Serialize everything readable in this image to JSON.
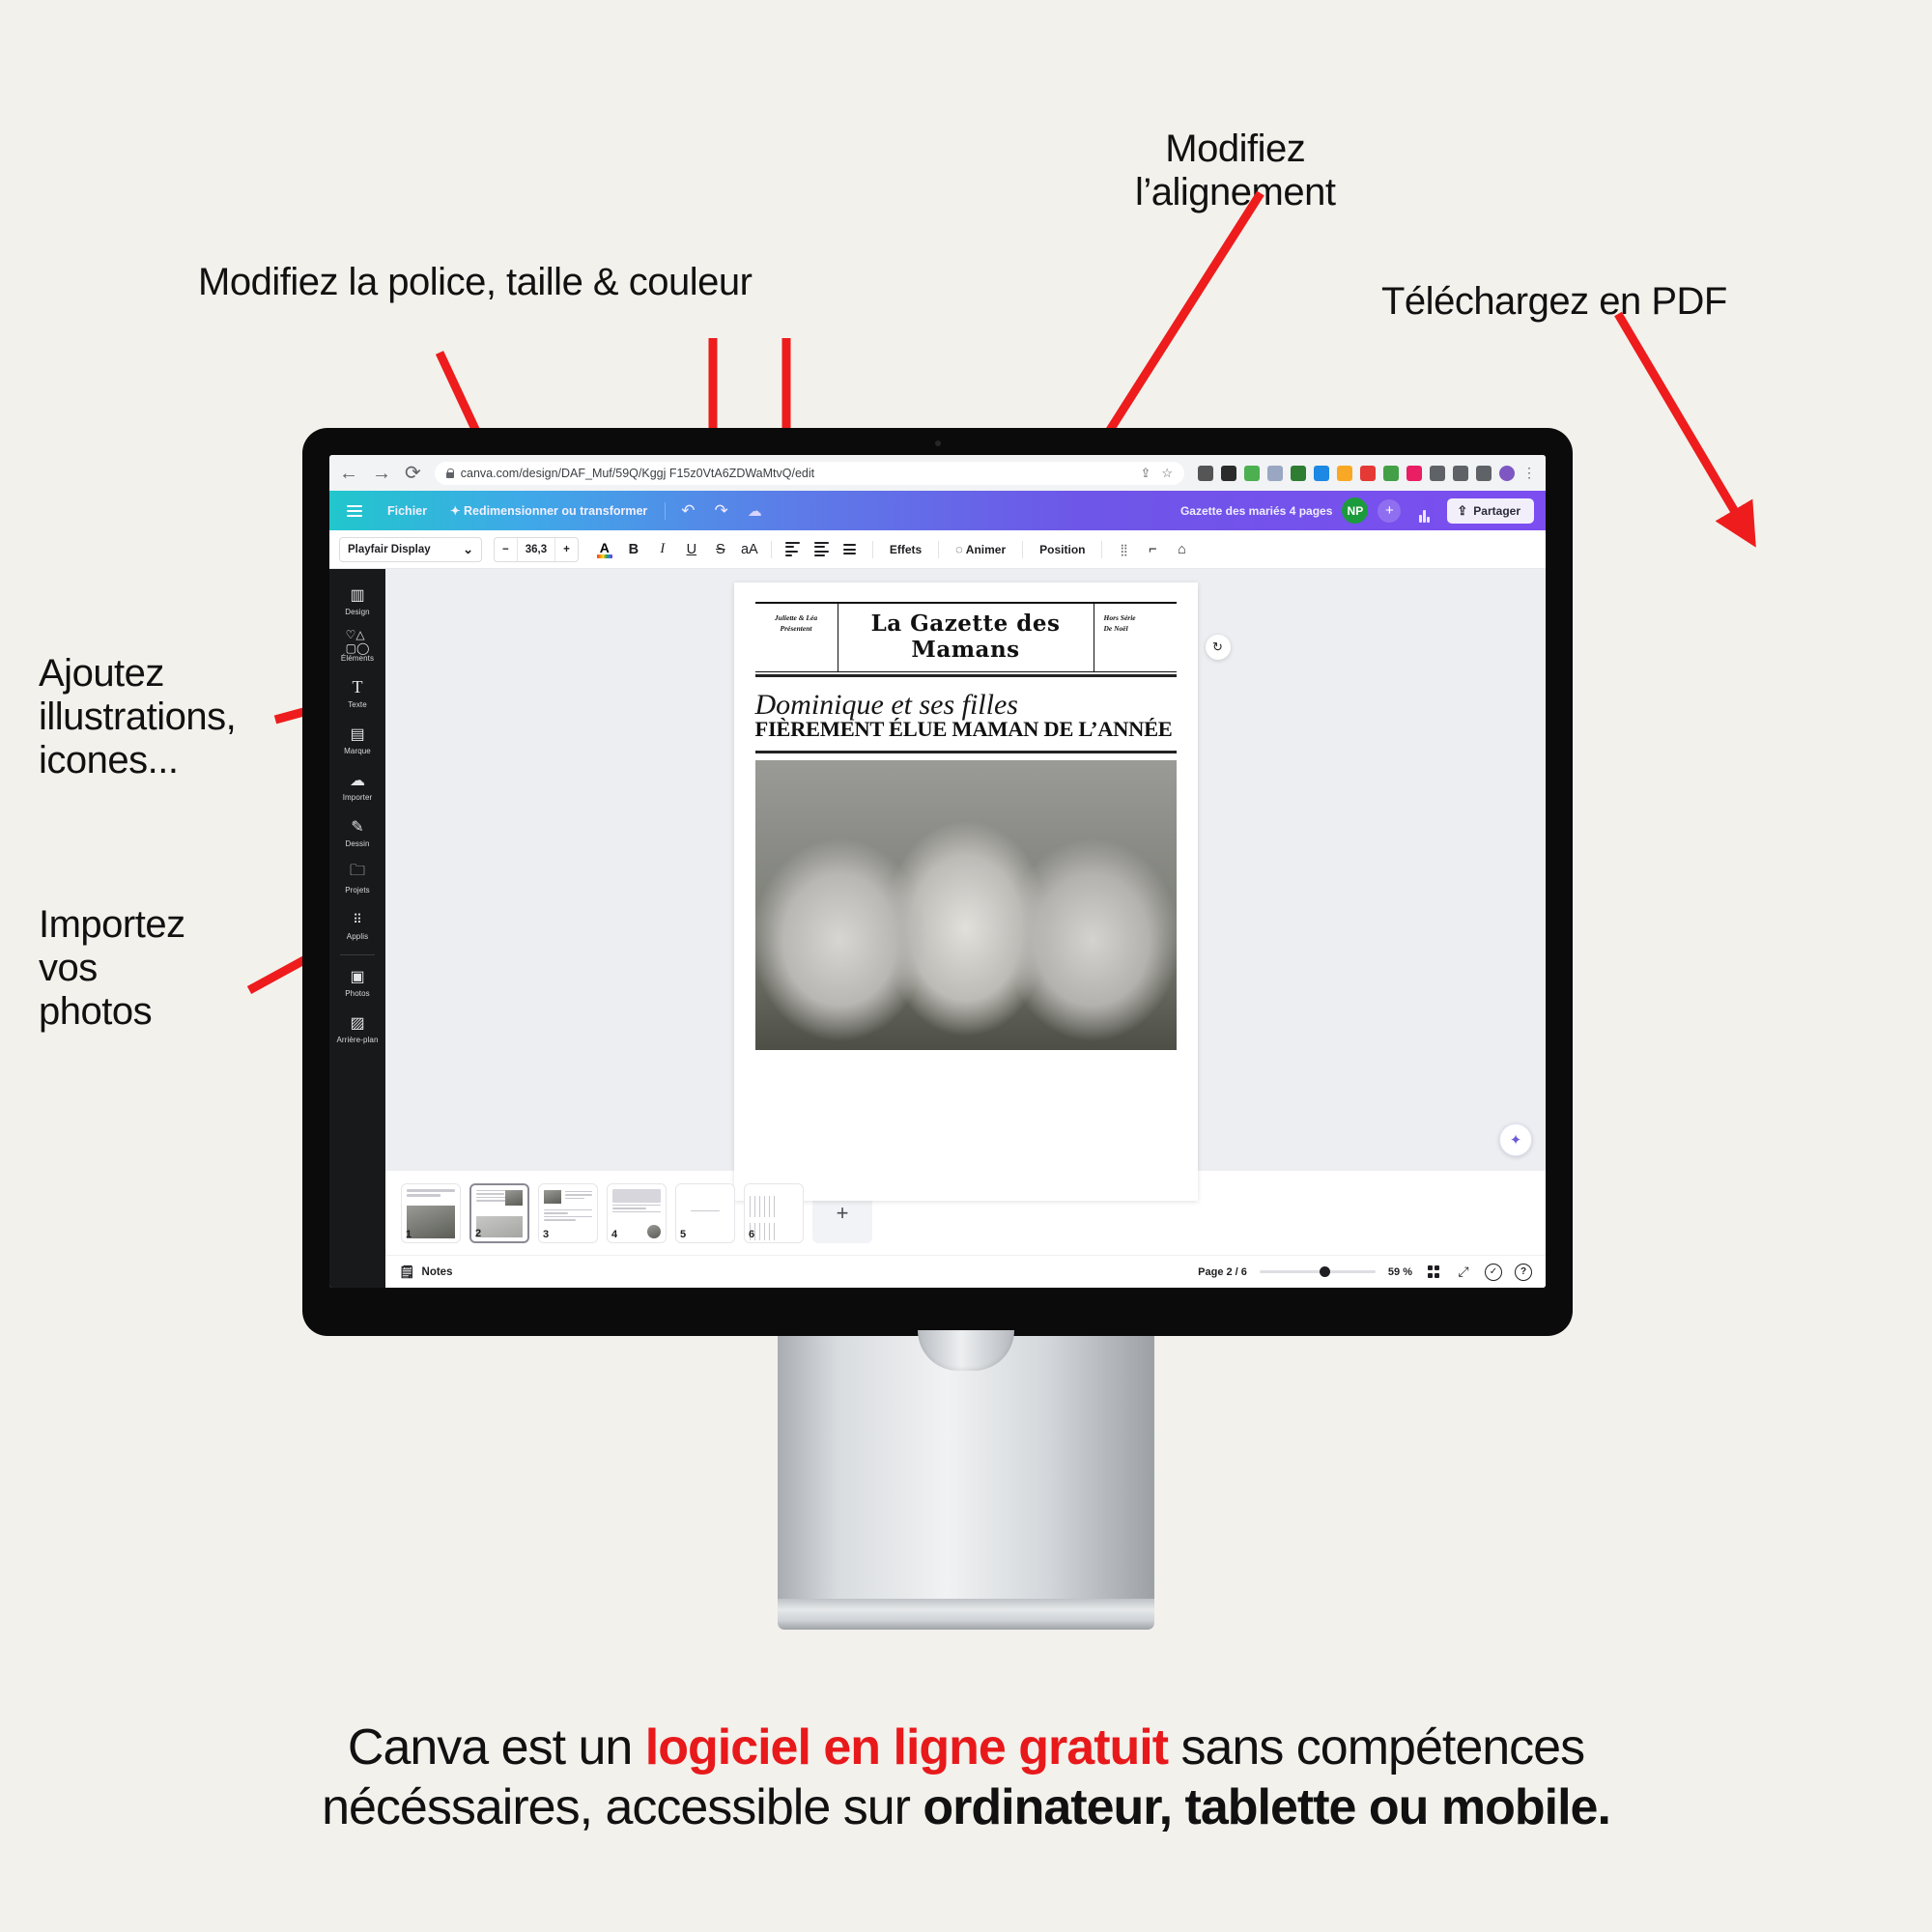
{
  "annotations": {
    "font": "Modifiez la police, taille & couleur",
    "align": "Modifiez\nl’alignement",
    "pdf": "Téléchargez en PDF",
    "elements": "Ajoutez\nillustrations,\nicones...",
    "upload": "Importez\nvos\nphotos"
  },
  "browser": {
    "back_icon": "←",
    "forward_icon": "→",
    "reload_icon": "⟳",
    "lock_icon": "lock-icon",
    "url": "canva.com/design/DAF_Muf/59Q/Kggj F15z0VtA6ZDWaMtvQ/edit",
    "share_icon": "⇪",
    "bookmark_icon": "☆",
    "menu_icon": "⋮"
  },
  "canva_header": {
    "menu_icon": "hamburger-icon",
    "file_label": "Fichier",
    "resize_label": "Redimensionner ou transformer",
    "resize_icon": "✦",
    "undo_icon": "↶",
    "redo_icon": "↷",
    "cloud_icon": "☁",
    "doc_title": "Gazette des mariés 4 pages",
    "avatar_initials": "NP",
    "add_collaborator_icon": "+",
    "stats_icon": "bar-chart-icon",
    "share_label": "Partager",
    "share_icon": "upload-icon"
  },
  "toolbar": {
    "font_name": "Playfair Display",
    "font_chevron": "⌄",
    "decrease_label": "−",
    "font_size": "36,3",
    "increase_label": "+",
    "text_color_letter": "A",
    "bold_label": "B",
    "italic_label": "I",
    "underline_label": "U",
    "strikethrough_label": "S",
    "case_label": "aA",
    "align_icon": "align-left-icon",
    "list_icon": "bullet-list-icon",
    "spacing_icon": "line-spacing-icon",
    "effects_label": "Effets",
    "animate_label": "Animer",
    "animate_icon": "circle-icon",
    "position_label": "Position",
    "transparency_icon": "⣿",
    "roller_icon": "paint-roller-icon",
    "lock_icon": "lock-icon"
  },
  "sidebar": {
    "items": [
      {
        "label": "Design",
        "icon": "layout-icon",
        "glyph": "▥"
      },
      {
        "label": "Éléments",
        "icon": "shapes-icon",
        "glyph": "♡△"
      },
      {
        "label": "Texte",
        "icon": "text-icon",
        "glyph": "T"
      },
      {
        "label": "Marque",
        "icon": "brand-icon",
        "glyph": "▤"
      },
      {
        "label": "Importer",
        "icon": "upload-cloud-icon",
        "glyph": "☁"
      },
      {
        "label": "Dessin",
        "icon": "pen-icon",
        "glyph": "✎"
      },
      {
        "label": "Projets",
        "icon": "folder-icon",
        "glyph": "🗀"
      },
      {
        "label": "Applis",
        "icon": "apps-grid-icon",
        "glyph": "⦙⦙"
      }
    ],
    "items_bottom": [
      {
        "label": "Photos",
        "icon": "image-icon",
        "glyph": "🖼"
      },
      {
        "label": "Arrière-plan",
        "icon": "hatch-icon",
        "glyph": "▨"
      }
    ]
  },
  "document": {
    "masthead_left": "Juliette & Léa\nPrésentent",
    "masthead_title": "La Gazette des Mamans",
    "masthead_right": "Hors Série\nDe Noël",
    "headline_script": "Dominique et ses filles",
    "headline_caps": "FIÈREMENT ÉLUE MAMAN DE L’ANNÉE",
    "comment_icon": "comment-icon",
    "magic_icon": "magic-wand-icon"
  },
  "thumbnails": [
    {
      "number": "1"
    },
    {
      "number": "2"
    },
    {
      "number": "3"
    },
    {
      "number": "4"
    },
    {
      "number": "5"
    },
    {
      "number": "6"
    }
  ],
  "add_page_label": "+",
  "statusbar": {
    "notes_label": "Notes",
    "notes_icon": "notes-icon",
    "page_indicator": "Page 2 / 6",
    "zoom_value": "59 %",
    "grid_icon": "grid-view-icon",
    "expand_icon": "⤢",
    "check_icon": "✓",
    "help_icon": "?"
  },
  "caption": {
    "part1": "Canva est un ",
    "highlight": "logiciel en ligne gratuit",
    "part2": " sans compétences",
    "part3": "nécéssaires, accessible sur ",
    "bold": "ordinateur, tablette ou mobile."
  },
  "colors": {
    "background": "#F2F1EC",
    "arrow_red": "#EE1C1C",
    "caption_red": "#E8191B",
    "avatar_green": "#1C9B3C",
    "sidebar_dark": "#18191B"
  }
}
